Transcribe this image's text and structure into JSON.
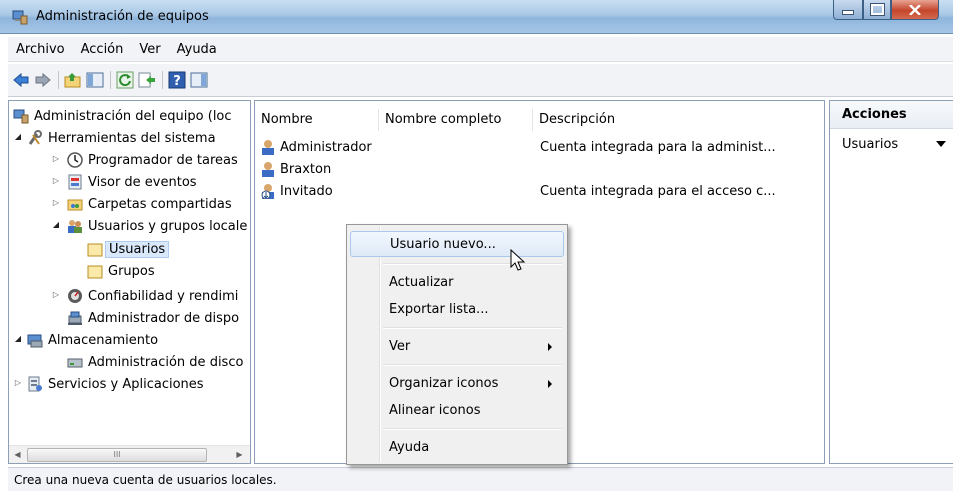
{
  "window": {
    "title": "Administración de equipos",
    "icon": "computer-management-icon"
  },
  "menu": [
    "Archivo",
    "Acción",
    "Ver",
    "Ayuda"
  ],
  "toolbar": {
    "buttons": [
      "back-icon",
      "forward-icon",
      "up-folder-icon",
      "show-hide-tree-icon",
      "refresh-icon",
      "export-icon",
      "help-icon",
      "action-pane-icon"
    ]
  },
  "tree": {
    "root": "Administración del equipo (loc",
    "system_tools": "Herramientas del sistema",
    "task_scheduler": "Programador de tareas",
    "event_viewer": "Visor de eventos",
    "shared_folders": "Carpetas compartidas",
    "local_users_groups": "Usuarios y grupos locale",
    "users": "Usuarios",
    "groups": "Grupos",
    "reliability": "Confiabilidad y rendimi",
    "device_manager": "Administrador de dispo",
    "storage": "Almacenamiento",
    "disk_management": "Administración de disco",
    "services_apps": "Servicios y Aplicaciones"
  },
  "list": {
    "columns": [
      "Nombre",
      "Nombre completo",
      "Descripción"
    ],
    "rows": [
      {
        "name": "Administrador",
        "full_name": "",
        "description": "Cuenta integrada para la administ..."
      },
      {
        "name": "Braxton",
        "full_name": "",
        "description": ""
      },
      {
        "name": "Invitado",
        "full_name": "",
        "description": "Cuenta integrada para el acceso c..."
      }
    ]
  },
  "actions": {
    "title": "Acciones",
    "item": "Usuarios"
  },
  "context_menu": {
    "new_user": "Usuario nuevo...",
    "refresh": "Actualizar",
    "export": "Exportar lista...",
    "view": "Ver",
    "arrange_icons": "Organizar iconos",
    "align_icons": "Alinear iconos",
    "help": "Ayuda"
  },
  "scrollbar": {
    "grip": "III"
  },
  "status": "Crea una nueva cuenta de usuarios locales.",
  "colors": {
    "title_bar": "#a9c8e6",
    "selection": "#d9e8fb",
    "menu_highlight": "#dfeaf8",
    "close_button": "#c4462c"
  }
}
